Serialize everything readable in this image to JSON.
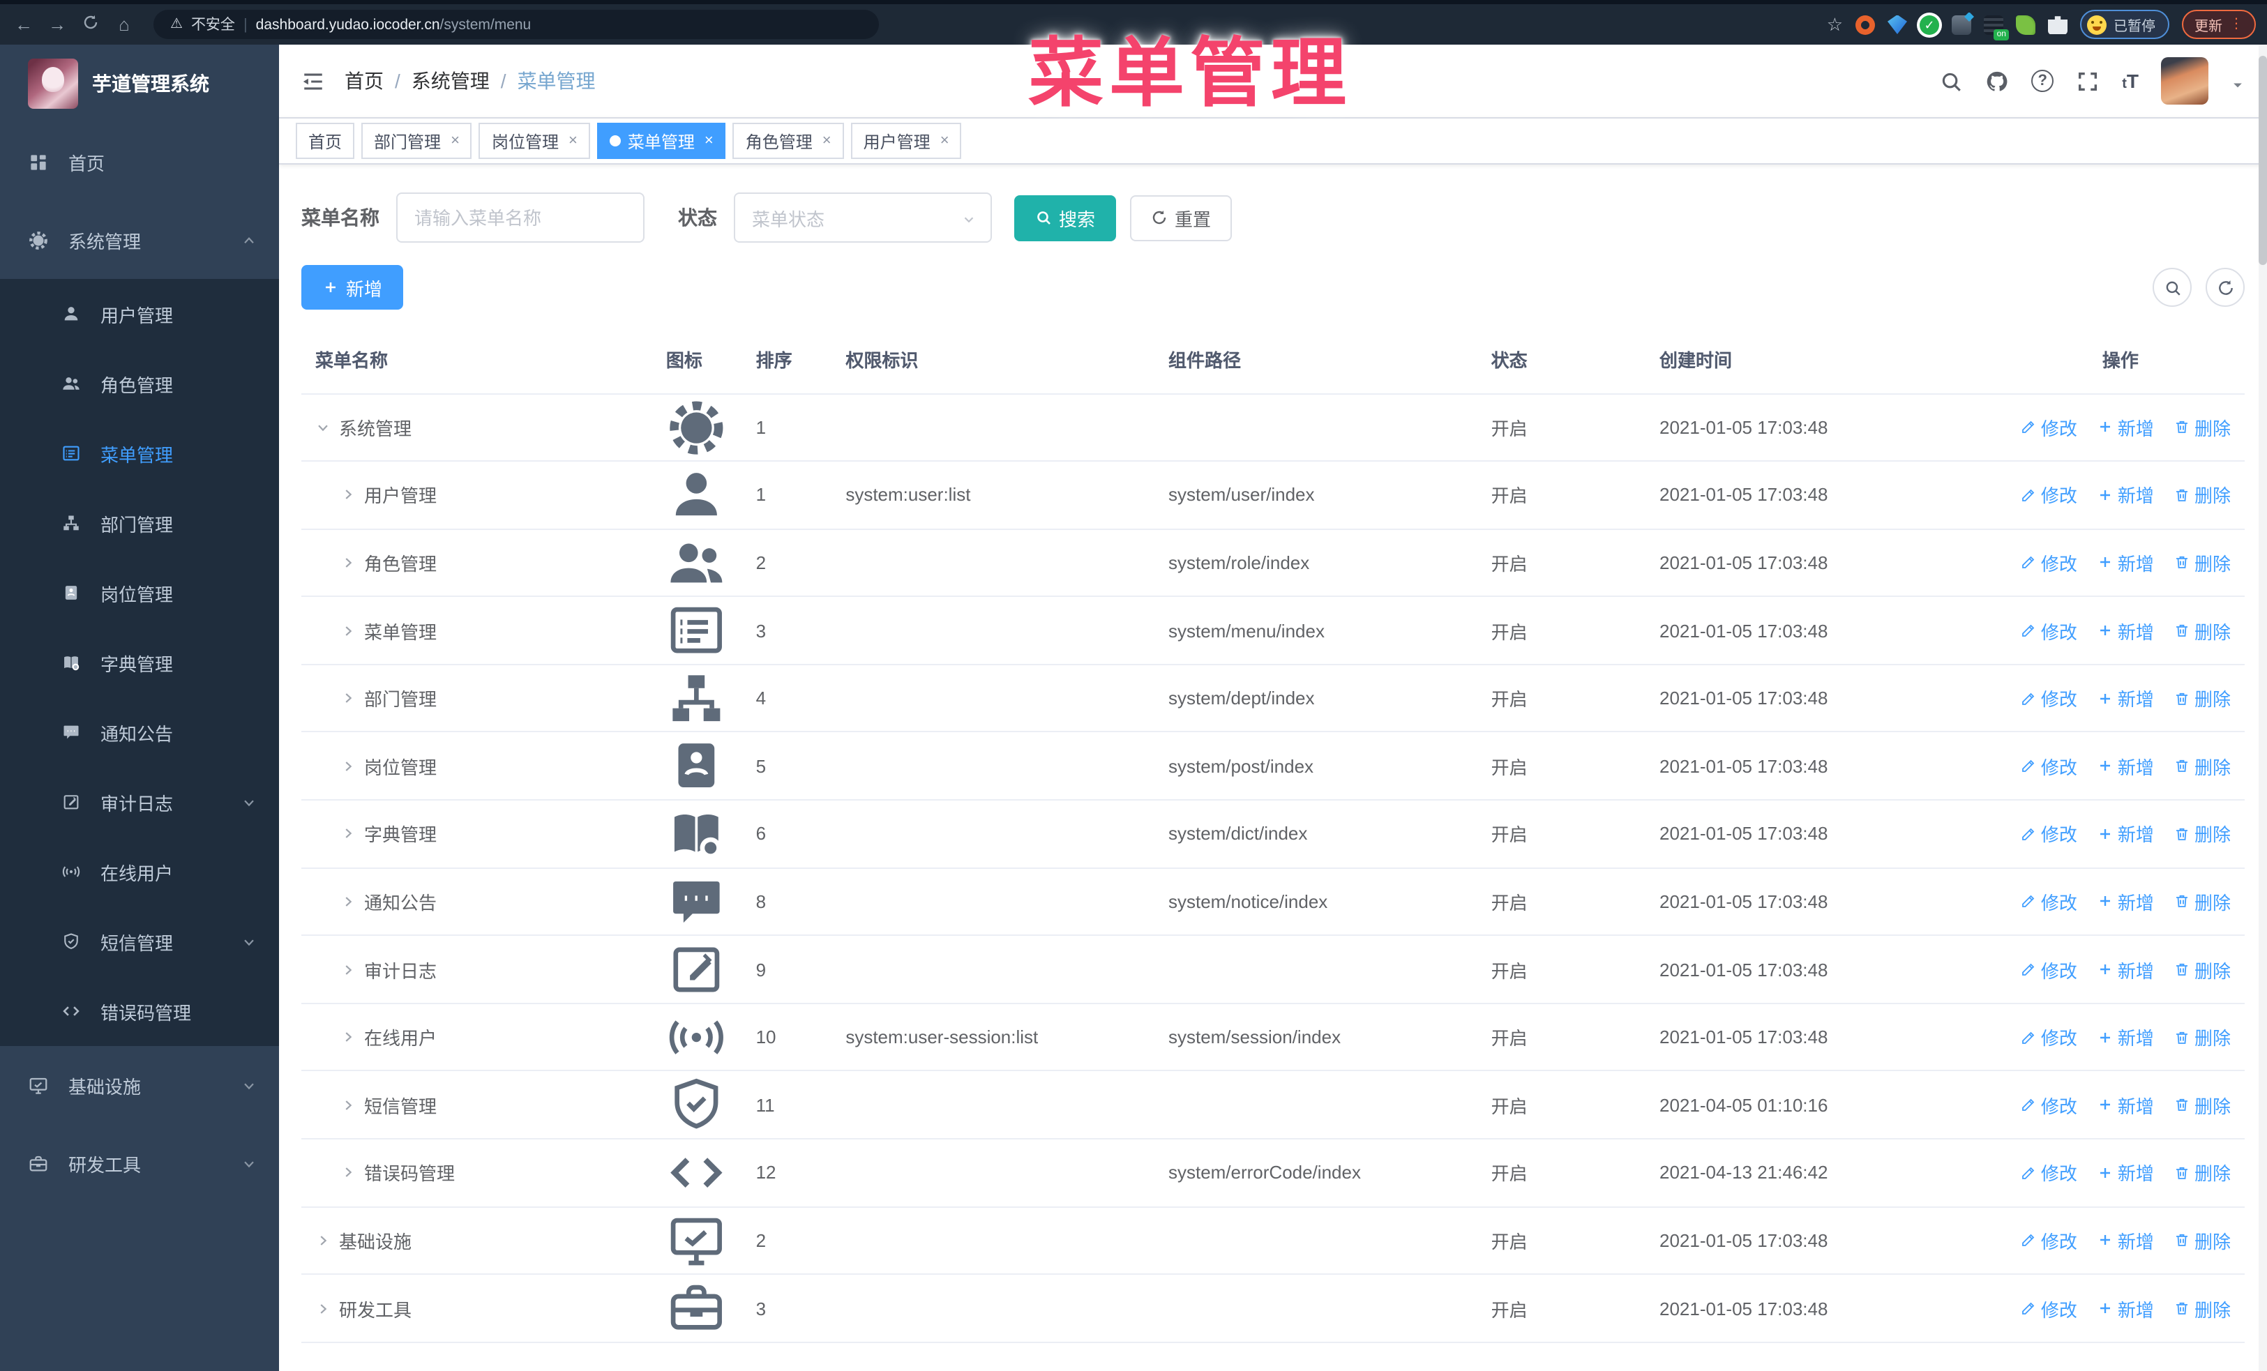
{
  "browser": {
    "security_label": "不安全",
    "url_host": "dashboard.yudao.iocoder.cn",
    "url_path": "/system/menu",
    "ext_on_badge": "on",
    "profile_chip_label": "已暂停",
    "update_button_label": "更新"
  },
  "overlay": {
    "title": "菜单管理",
    "color": "#f4436c"
  },
  "sidebar": {
    "logo_title": "芋道管理系统",
    "items": [
      {
        "label": "首页",
        "icon": "dashboard-icon",
        "level": 0
      },
      {
        "label": "系统管理",
        "icon": "gear-icon",
        "level": 0,
        "caret": "up"
      },
      {
        "label": "用户管理",
        "icon": "user-icon",
        "level": 1
      },
      {
        "label": "角色管理",
        "icon": "users-icon",
        "level": 1
      },
      {
        "label": "菜单管理",
        "icon": "menu-list-icon",
        "level": 1,
        "active": true
      },
      {
        "label": "部门管理",
        "icon": "tree-icon",
        "level": 1
      },
      {
        "label": "岗位管理",
        "icon": "badge-icon",
        "level": 1
      },
      {
        "label": "字典管理",
        "icon": "book-icon",
        "level": 1
      },
      {
        "label": "通知公告",
        "icon": "chat-icon",
        "level": 1
      },
      {
        "label": "审计日志",
        "icon": "edit-log-icon",
        "level": 1,
        "caret": "down"
      },
      {
        "label": "在线用户",
        "icon": "signal-icon",
        "level": 1
      },
      {
        "label": "短信管理",
        "icon": "shield-icon",
        "level": 1,
        "caret": "down"
      },
      {
        "label": "错误码管理",
        "icon": "code-icon",
        "level": 1
      },
      {
        "label": "基础设施",
        "icon": "monitor-icon",
        "level": 0,
        "caret": "down"
      },
      {
        "label": "研发工具",
        "icon": "toolbox-icon",
        "level": 0,
        "caret": "down"
      }
    ]
  },
  "breadcrumb": {
    "items": [
      "首页",
      "系统管理",
      "菜单管理"
    ],
    "separator": "/"
  },
  "tabs": [
    {
      "label": "首页",
      "closable": false,
      "active": false
    },
    {
      "label": "部门管理",
      "closable": true,
      "active": false
    },
    {
      "label": "岗位管理",
      "closable": true,
      "active": false
    },
    {
      "label": "菜单管理",
      "closable": true,
      "active": true
    },
    {
      "label": "角色管理",
      "closable": true,
      "active": false
    },
    {
      "label": "用户管理",
      "closable": true,
      "active": false
    }
  ],
  "search": {
    "name_label": "菜单名称",
    "name_placeholder": "请输入菜单名称",
    "status_label": "状态",
    "status_placeholder": "菜单状态",
    "search_button": "搜索",
    "reset_button": "重置"
  },
  "toolbar": {
    "add_button": "新增"
  },
  "table": {
    "headers": [
      "菜单名称",
      "图标",
      "排序",
      "权限标识",
      "组件路径",
      "状态",
      "创建时间",
      "操作"
    ],
    "status_open": "开启",
    "actions": {
      "edit": "修改",
      "add": "新增",
      "delete": "删除"
    },
    "rows": [
      {
        "name": "系统管理",
        "icon": "gear-icon",
        "level": 0,
        "caret": "down",
        "sort": "1",
        "perm": "",
        "path": "",
        "status": "开启",
        "time": "2021-01-05 17:03:48"
      },
      {
        "name": "用户管理",
        "icon": "user-icon",
        "level": 1,
        "caret": "right",
        "sort": "1",
        "perm": "system:user:list",
        "path": "system/user/index",
        "status": "开启",
        "time": "2021-01-05 17:03:48"
      },
      {
        "name": "角色管理",
        "icon": "users-icon",
        "level": 1,
        "caret": "right",
        "sort": "2",
        "perm": "",
        "path": "system/role/index",
        "status": "开启",
        "time": "2021-01-05 17:03:48"
      },
      {
        "name": "菜单管理",
        "icon": "menu-list-icon",
        "level": 1,
        "caret": "right",
        "sort": "3",
        "perm": "",
        "path": "system/menu/index",
        "status": "开启",
        "time": "2021-01-05 17:03:48"
      },
      {
        "name": "部门管理",
        "icon": "tree-icon",
        "level": 1,
        "caret": "right",
        "sort": "4",
        "perm": "",
        "path": "system/dept/index",
        "status": "开启",
        "time": "2021-01-05 17:03:48"
      },
      {
        "name": "岗位管理",
        "icon": "badge-icon",
        "level": 1,
        "caret": "right",
        "sort": "5",
        "perm": "",
        "path": "system/post/index",
        "status": "开启",
        "time": "2021-01-05 17:03:48"
      },
      {
        "name": "字典管理",
        "icon": "book-icon",
        "level": 1,
        "caret": "right",
        "sort": "6",
        "perm": "",
        "path": "system/dict/index",
        "status": "开启",
        "time": "2021-01-05 17:03:48"
      },
      {
        "name": "通知公告",
        "icon": "chat-icon",
        "level": 1,
        "caret": "right",
        "sort": "8",
        "perm": "",
        "path": "system/notice/index",
        "status": "开启",
        "time": "2021-01-05 17:03:48"
      },
      {
        "name": "审计日志",
        "icon": "edit-log-icon",
        "level": 1,
        "caret": "right",
        "sort": "9",
        "perm": "",
        "path": "",
        "status": "开启",
        "time": "2021-01-05 17:03:48"
      },
      {
        "name": "在线用户",
        "icon": "signal-icon",
        "level": 1,
        "caret": "right",
        "sort": "10",
        "perm": "system:user-session:list",
        "path": "system/session/index",
        "status": "开启",
        "time": "2021-01-05 17:03:48"
      },
      {
        "name": "短信管理",
        "icon": "shield-icon",
        "level": 1,
        "caret": "right",
        "sort": "11",
        "perm": "",
        "path": "",
        "status": "开启",
        "time": "2021-04-05 01:10:16"
      },
      {
        "name": "错误码管理",
        "icon": "code-icon",
        "level": 1,
        "caret": "right",
        "sort": "12",
        "perm": "",
        "path": "system/errorCode/index",
        "status": "开启",
        "time": "2021-04-13 21:46:42"
      },
      {
        "name": "基础设施",
        "icon": "monitor-icon",
        "level": 0,
        "caret": "right",
        "sort": "2",
        "perm": "",
        "path": "",
        "status": "开启",
        "time": "2021-01-05 17:03:48"
      },
      {
        "name": "研发工具",
        "icon": "toolbox-icon",
        "level": 0,
        "caret": "right",
        "sort": "3",
        "perm": "",
        "path": "",
        "status": "开启",
        "time": "2021-01-05 17:03:48"
      }
    ]
  }
}
